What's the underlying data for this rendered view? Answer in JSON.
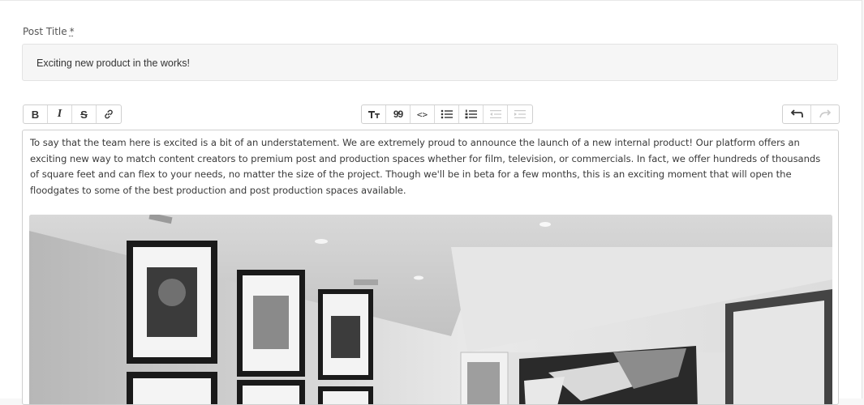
{
  "form": {
    "title_label": "Post Title",
    "title_required_marker": "*",
    "title_value": "Exciting new product in the works!"
  },
  "toolbar": {
    "format_group": [
      {
        "name": "bold-button",
        "icon": "bold-icon",
        "glyph": "B",
        "enabled": true
      },
      {
        "name": "italic-button",
        "icon": "italic-icon",
        "glyph": "I",
        "enabled": true
      },
      {
        "name": "strikethrough-button",
        "icon": "strikethrough-icon",
        "glyph": "S",
        "enabled": true
      },
      {
        "name": "link-button",
        "icon": "link-icon",
        "glyph": "",
        "enabled": true
      }
    ],
    "block_group": [
      {
        "name": "heading-button",
        "icon": "text-size-icon",
        "enabled": true
      },
      {
        "name": "quote-button",
        "icon": "quote-icon",
        "glyph": "99",
        "enabled": true
      },
      {
        "name": "code-button",
        "icon": "code-icon",
        "glyph": "<>",
        "enabled": true
      },
      {
        "name": "bullet-list-button",
        "icon": "bullet-list-icon",
        "enabled": true
      },
      {
        "name": "numbered-list-button",
        "icon": "numbered-list-icon",
        "enabled": true
      },
      {
        "name": "outdent-button",
        "icon": "outdent-icon",
        "enabled": false
      },
      {
        "name": "indent-button",
        "icon": "indent-icon",
        "enabled": false
      }
    ],
    "history_group": [
      {
        "name": "undo-button",
        "icon": "undo-icon",
        "enabled": true
      },
      {
        "name": "redo-button",
        "icon": "redo-icon",
        "enabled": false
      }
    ]
  },
  "editor": {
    "body": "To say that the team here is excited is a bit of an understatement. We are extremely proud to announce the launch of a new internal product! Our platform offers an exciting new way to match content creators to premium post and production spaces whether for film, television, or commercials. In fact, we offer hundreds of thousands of square feet and can flex to your needs, no matter the size of the project. Though we'll be in beta for a few months, this is an exciting moment that will open the floodgates to some of the best production and post production spaces available.",
    "image_description": "embedded-photo"
  },
  "colors": {
    "border": "#cfcfcf",
    "input_bg": "#f6f6f6",
    "text": "#333333",
    "disabled": "#c9c9c9"
  }
}
